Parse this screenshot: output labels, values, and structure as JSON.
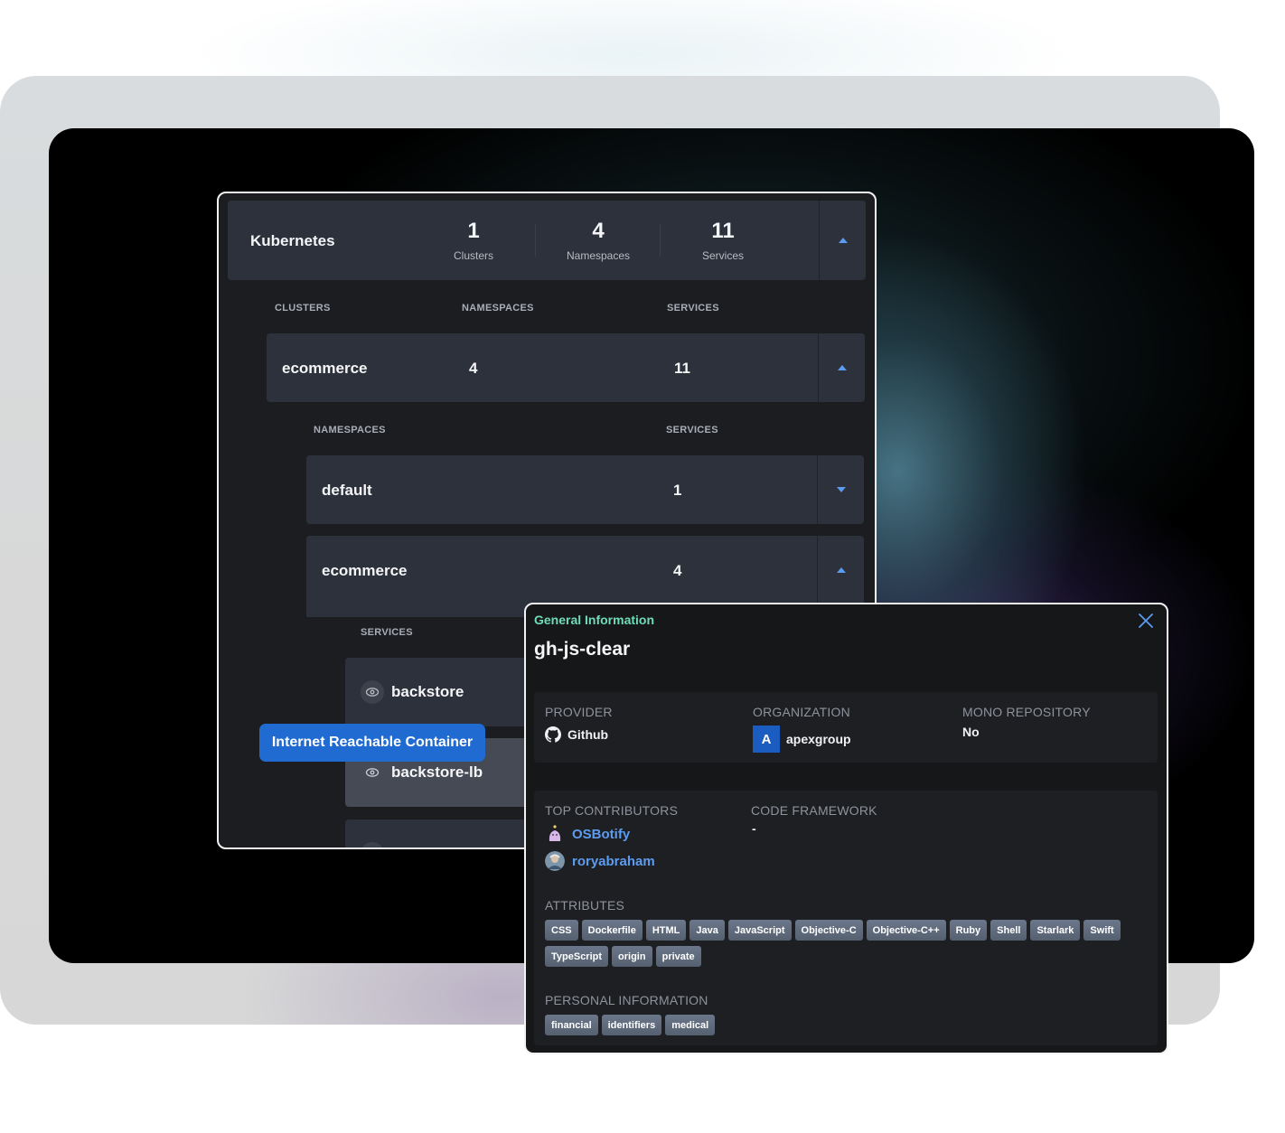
{
  "kubernetes": {
    "title": "Kubernetes",
    "stats": [
      {
        "value": "1",
        "label": "Clusters"
      },
      {
        "value": "4",
        "label": "Namespaces"
      },
      {
        "value": "11",
        "label": "Services"
      }
    ],
    "cluster_headers": {
      "clusters": "CLUSTERS",
      "namespaces": "NAMESPACES",
      "services": "SERVICES"
    },
    "clusters": [
      {
        "name": "ecommerce",
        "namespaces": "4",
        "services": "11",
        "expanded": true
      }
    ],
    "namespace_headers": {
      "namespaces": "NAMESPACES",
      "services": "SERVICES"
    },
    "namespaces": [
      {
        "name": "default",
        "services": "1",
        "expanded": false
      },
      {
        "name": "ecommerce",
        "services": "4",
        "expanded": true
      }
    ],
    "service_header": "SERVICES",
    "services": [
      {
        "name": "backstore",
        "icon": "eye-icon"
      },
      {
        "name": "backstore-lb",
        "icon": "eye-icon"
      }
    ],
    "tooltip": "Internet Reachable Container"
  },
  "detail": {
    "eyebrow": "General Information",
    "title": "gh-js-clear",
    "provider": {
      "label": "PROVIDER",
      "value": "Github",
      "icon": "github-icon"
    },
    "organization": {
      "label": "ORGANIZATION",
      "value": "apexgroup",
      "avatar_letter": "A"
    },
    "mono_repository": {
      "label": "MONO REPOSITORY",
      "value": "No"
    },
    "top_contributors": {
      "label": "TOP CONTRIBUTORS",
      "items": [
        {
          "name": "OSBotify",
          "avatar": "bot-avatar"
        },
        {
          "name": "roryabraham",
          "avatar": "user-avatar"
        }
      ]
    },
    "code_framework": {
      "label": "CODE FRAMEWORK",
      "value": "-"
    },
    "attributes": {
      "label": "ATTRIBUTES",
      "tags": [
        "CSS",
        "Dockerfile",
        "HTML",
        "Java",
        "JavaScript",
        "Objective-C",
        "Objective-C++",
        "Ruby",
        "Shell",
        "Starlark",
        "Swift",
        "TypeScript",
        "origin",
        "private"
      ]
    },
    "personal_information": {
      "label": "PERSONAL INFORMATION",
      "tags": [
        "financial",
        "identifiers",
        "medical"
      ]
    }
  },
  "colors": {
    "accent_blue": "#5b9bf0",
    "tooltip_blue": "#1f6bd1",
    "eyebrow_green": "#6fdcb6",
    "org_avatar": "#1a5cc0"
  }
}
